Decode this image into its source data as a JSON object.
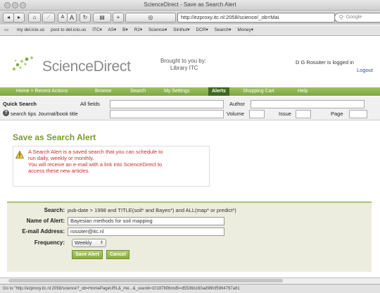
{
  "window": {
    "title": "ScienceDirect - Save as Search Alert"
  },
  "toolbar": {
    "back": "◂",
    "forward": "▸",
    "home": "⌂",
    "small_a": "A",
    "big_a": "A",
    "reload": "↻",
    "add": "+",
    "url": "http://ezproxy.itc.nl:2058/science/_ob=Mai",
    "search_placeholder": "Q- Google"
  },
  "bookmarks": [
    "my del.icio.us",
    "post to del.icio.us",
    "ITC▾",
    "AS▾",
    "B▾",
    "R2▾",
    "Science▾",
    "Sinthut▾",
    "DCR▾",
    "Search▾",
    "Money▾"
  ],
  "header": {
    "logo": "ScienceDirect",
    "brought_line1": "Brought to you by:",
    "brought_line2": "Library ITC",
    "user": "D G Rossiter is logged in",
    "logout": "Logout"
  },
  "nav": [
    "Home + Recent Actions",
    "Browse",
    "Search",
    "My Settings",
    "Alerts",
    "Shopping Cart",
    "Help"
  ],
  "quick_search": {
    "title": "Quick Search",
    "all_fields": "All fields",
    "author": "Author",
    "search_tips": "search tips",
    "journal": "Journal/book title",
    "volume": "Volume",
    "issue": "Issue",
    "page": "Page"
  },
  "page_title": "Save as Search Alert",
  "warning": {
    "line1": "A Search Alert is a saved search that you can schedule to",
    "line2": "run daily, weekly or monthly.",
    "line3": "You will receive an e-mail with a link into ScienceDirect to",
    "line4": "access these new articles."
  },
  "form": {
    "search_label": "Search:",
    "search_value": "pub-date > 1998 and TITLE(soil* and Bayes*) and ALL(map* or predict*)",
    "name_label": "Name of Alert:",
    "name_value": "Bayesian methods for soil mapping",
    "email_label": "E-mail Address:",
    "email_value": "rossiter@itc.nl",
    "frequency_label": "Frequency:",
    "frequency_value": "Weekly",
    "save_label": "Save Alert",
    "cancel_label": "Cancel"
  },
  "status": {
    "text": "Go to \"http://ezproxy.itc.nl:2058/science?_ob=HomePageURL&_me...&_userid=10187806md5=d5536b160ad96fcf5964767a61"
  },
  "colors": {
    "brand_green": "#7da642",
    "warning_red": "#cc2b2b",
    "link_blue": "#2a52a0"
  }
}
